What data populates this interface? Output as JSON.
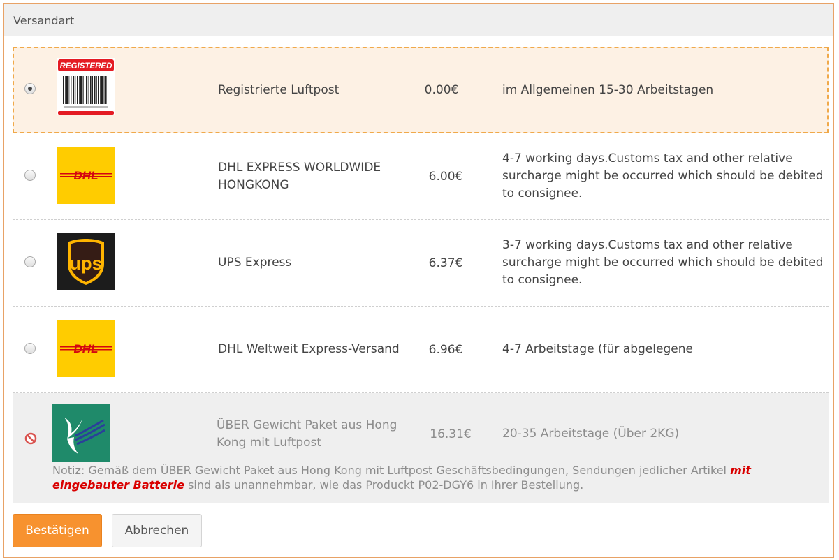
{
  "header": {
    "title": "Versandart"
  },
  "shipping_options": [
    {
      "logo": "registered-mail-icon",
      "logo_text": "REGISTERED",
      "name": "Registrierte Luftpost",
      "price": "0.00€",
      "desc": "im Allgemeinen 15-30 Arbeitstagen",
      "selected": true
    },
    {
      "logo": "dhl-logo",
      "logo_text": "DHL",
      "name": "DHL EXPRESS WORLDWIDE HONGKONG",
      "price": "6.00€",
      "desc": "4-7 working days.Customs tax and other relative surcharge might be occurred which should be debited to consignee."
    },
    {
      "logo": "ups-logo",
      "logo_text": "ups",
      "name": "UPS Express",
      "price": "6.37€",
      "desc": "3-7 working days.Customs tax and other relative surcharge might be occurred which should be debited to consignee."
    },
    {
      "logo": "dhl-logo",
      "logo_text": "DHL",
      "name": "DHL Weltweit Express-Versand",
      "price": "6.96€",
      "desc": "4-7 Arbeitstage (für abgelegene"
    },
    {
      "logo": "hongkong-post-logo",
      "name": "ÜBER Gewicht Paket aus Hong Kong mit Luftpost",
      "price": "16.31€",
      "desc": "20-35 Arbeitstage (Über 2KG)",
      "disabled": true,
      "note_prefix": "Notiz: Gemäß dem ÜBER Gewicht Paket aus Hong Kong mit Luftpost Geschäftsbedingungen, Sendungen jedlicher Artikel ",
      "note_highlight": "mit eingebauter Batterie",
      "note_suffix": " sind als unannehmbar, wie das Produckt P02-DGY6 in Ihrer Bestellung."
    }
  ],
  "buttons": {
    "confirm": "Bestätigen",
    "cancel": "Abbrechen"
  },
  "colors": {
    "accent": "#f7922f",
    "selected_bg": "#fdf1e4",
    "warning": "#d90000",
    "dhl_yellow": "#ffcc00",
    "dhl_red": "#d40511",
    "ups_brown": "#351c15",
    "ups_gold": "#ffb500"
  }
}
